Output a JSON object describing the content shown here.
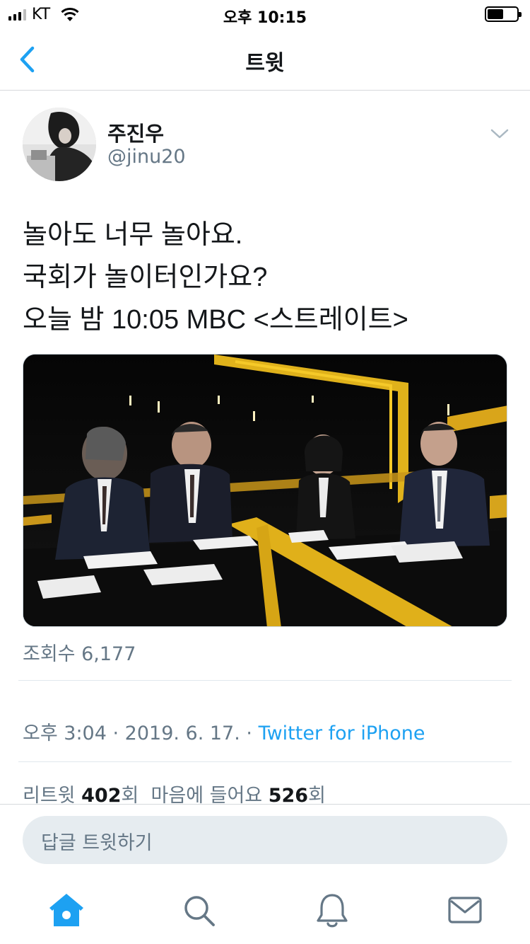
{
  "status_bar": {
    "carrier": "KT",
    "time": "오후 10:15"
  },
  "nav": {
    "title": "트윗",
    "back_icon": "chevron-left-icon"
  },
  "tweet": {
    "author_name": "주진우",
    "author_handle": "@jinu20",
    "text_lines": [
      "놀아도 너무 놀아요.",
      "국회가 놀이터인가요?",
      "오늘 밤 10:05 MBC <스트레이트>"
    ],
    "views": "조회수 6,177",
    "time": "오후 3:04",
    "separator": " · ",
    "date": "2019. 6. 17.",
    "source": "Twitter for iPhone",
    "retweet_label": "리트윗",
    "retweet_count": "402",
    "like_label": "마음에 들어요",
    "like_count": "526",
    "count_suffix": "회"
  },
  "reply": {
    "placeholder": "답글 트윗하기"
  },
  "tabbar": {
    "items": [
      "home-icon",
      "search-icon",
      "notifications-icon",
      "messages-icon"
    ],
    "active": "home-icon"
  },
  "colors": {
    "accent": "#1da1f2",
    "secondary_text": "#657786",
    "primary_text": "#14171a",
    "reply_bg": "#e6ecf0"
  }
}
